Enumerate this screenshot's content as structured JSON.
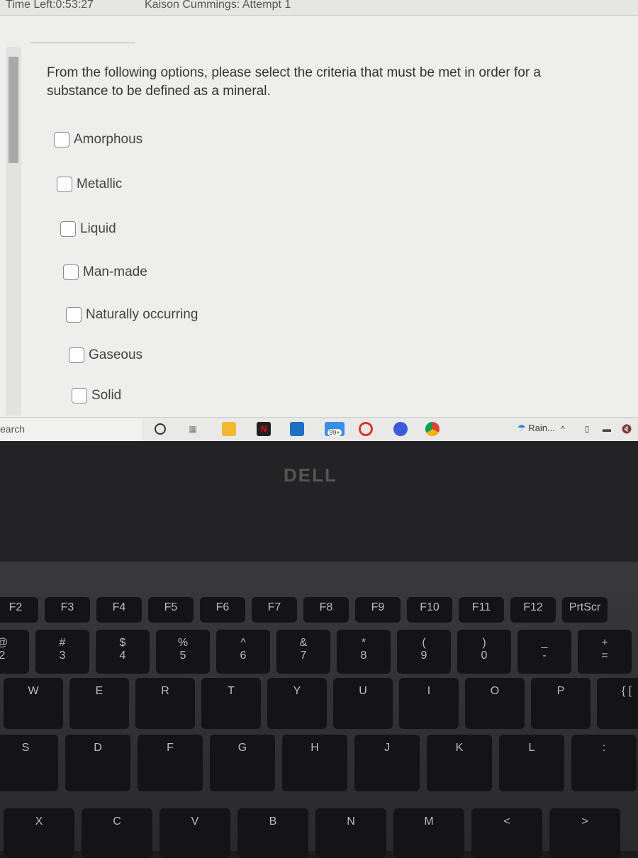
{
  "header": {
    "timer": "Time Left:0:53:27",
    "attempt": "Kaison Cummings: Attempt 1"
  },
  "question": {
    "text": "From the following options, please select the criteria that must be met in order for a substance to be defined as a mineral.",
    "options": [
      {
        "label": "Amorphous",
        "checked": false
      },
      {
        "label": "Metallic",
        "checked": false
      },
      {
        "label": "Liquid",
        "checked": false
      },
      {
        "label": "Man-made",
        "checked": false
      },
      {
        "label": "Naturally occurring",
        "checked": false
      },
      {
        "label": "Gaseous",
        "checked": false
      },
      {
        "label": "Solid",
        "checked": false
      }
    ]
  },
  "taskbar": {
    "search_placeholder": "earch",
    "mail_badge": "99+",
    "weather": "Rain...",
    "icons": [
      "cortana-icon",
      "task-view-icon",
      "file-explorer-icon",
      "netflix-icon",
      "store-icon",
      "mail-icon",
      "opera-icon",
      "app-icon",
      "chrome-icon"
    ]
  },
  "laptop": {
    "brand": "DELL"
  },
  "keyboard": {
    "fn": [
      "F2",
      "F3",
      "F4",
      "F5",
      "F6",
      "F7",
      "F8",
      "F9",
      "F10",
      "F11",
      "F12",
      "PrtScr"
    ],
    "num": [
      [
        "@",
        "2"
      ],
      [
        "#",
        "3"
      ],
      [
        "$",
        "4"
      ],
      [
        "%",
        "5"
      ],
      [
        "^",
        "6"
      ],
      [
        "&",
        "7"
      ],
      [
        "*",
        "8"
      ],
      [
        "(",
        "9"
      ],
      [
        ")",
        "0"
      ],
      [
        "_",
        "-"
      ],
      [
        "+",
        "="
      ]
    ],
    "qwerty": [
      "W",
      "E",
      "R",
      "T",
      "Y",
      "U",
      "I",
      "O",
      "P",
      "{ ["
    ],
    "home": [
      "S",
      "D",
      "F",
      "G",
      "H",
      "J",
      "K",
      "L",
      ":"
    ],
    "bottom": [
      "X",
      "C",
      "V",
      "B",
      "N",
      "M",
      "<",
      ">"
    ]
  }
}
